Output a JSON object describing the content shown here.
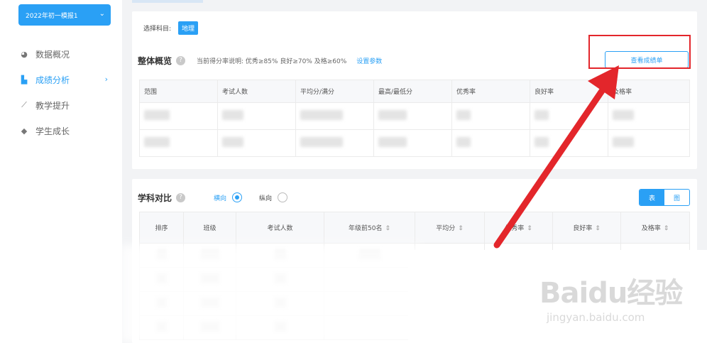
{
  "sidebar": {
    "term_select": "2022年初一模报1",
    "items": [
      {
        "label": "数据概况",
        "icon": "pie-icon"
      },
      {
        "label": "成绩分析",
        "icon": "bar-chart-icon",
        "active": true
      },
      {
        "label": "教学提升",
        "icon": "trend-icon"
      },
      {
        "label": "学生成长",
        "icon": "graduation-cap-icon"
      }
    ]
  },
  "overview": {
    "subject_label": "选择科目:",
    "subject_value": "地理",
    "title": "整体概览",
    "description": "当前得分率说明: 优秀≥85% 良好≥70% 及格≥60%",
    "settings_link": "设置参数",
    "view_button": "查看成绩单",
    "columns": [
      "范围",
      "考试人数",
      "平均分/满分",
      "最高/最低分",
      "优秀率",
      "良好率",
      "及格率"
    ]
  },
  "comparison": {
    "title": "学科对比",
    "radio_horizontal": "横向",
    "radio_vertical": "纵向",
    "toggle_left": "表",
    "toggle_right": "图",
    "columns": [
      "排序",
      "班级",
      "考试人数",
      "年级前50名",
      "平均分",
      "优秀率",
      "良好率",
      "及格率"
    ]
  },
  "watermark": {
    "main": "Baidu经验",
    "sub": "jingyan.baidu.com"
  },
  "colors": {
    "accent": "#2aa0f5",
    "highlight": "#e3262b"
  }
}
